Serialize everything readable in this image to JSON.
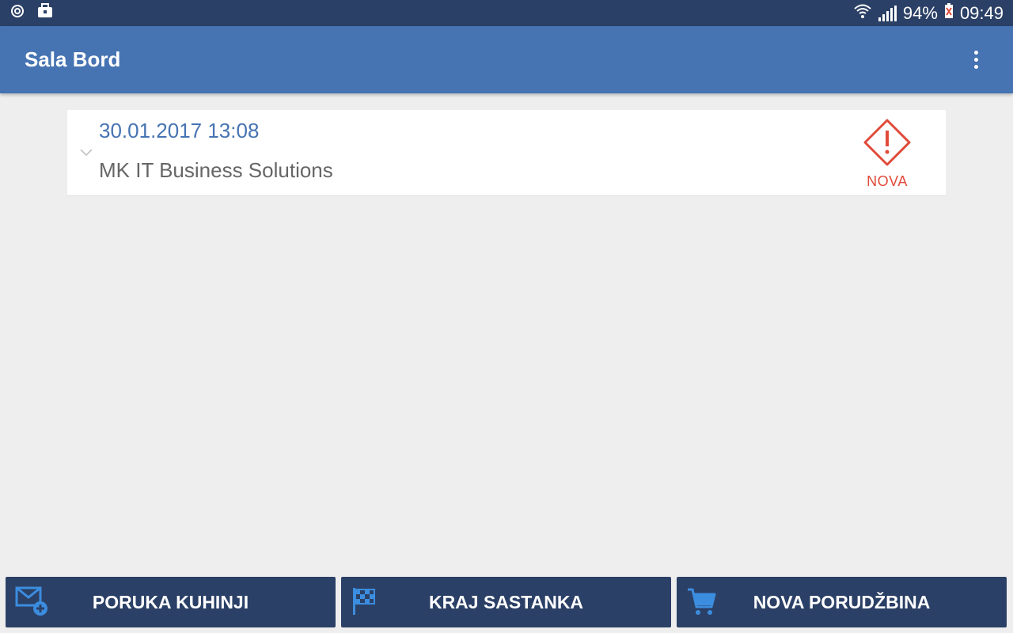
{
  "status_bar": {
    "battery": "94%",
    "time": "09:49"
  },
  "app_bar": {
    "title": "Sala Bord"
  },
  "orders": [
    {
      "datetime": "30.01.2017 13:08",
      "company": "MK IT Business Solutions",
      "status": "NOVA"
    }
  ],
  "bottom_actions": [
    {
      "label": "PORUKA KUHINJI",
      "icon": "mail-add-icon"
    },
    {
      "label": "KRAJ SASTANKA",
      "icon": "checkered-flag-icon"
    },
    {
      "label": "NOVA PORUDŽBINA",
      "icon": "shopping-cart-icon"
    }
  ],
  "colors": {
    "status_bar": "#2b4066",
    "app_bar": "#4673b2",
    "background": "#eeeeee",
    "accent_red": "#e04a3a",
    "button_bg": "#2b4066",
    "button_icon": "#3b8de0"
  }
}
